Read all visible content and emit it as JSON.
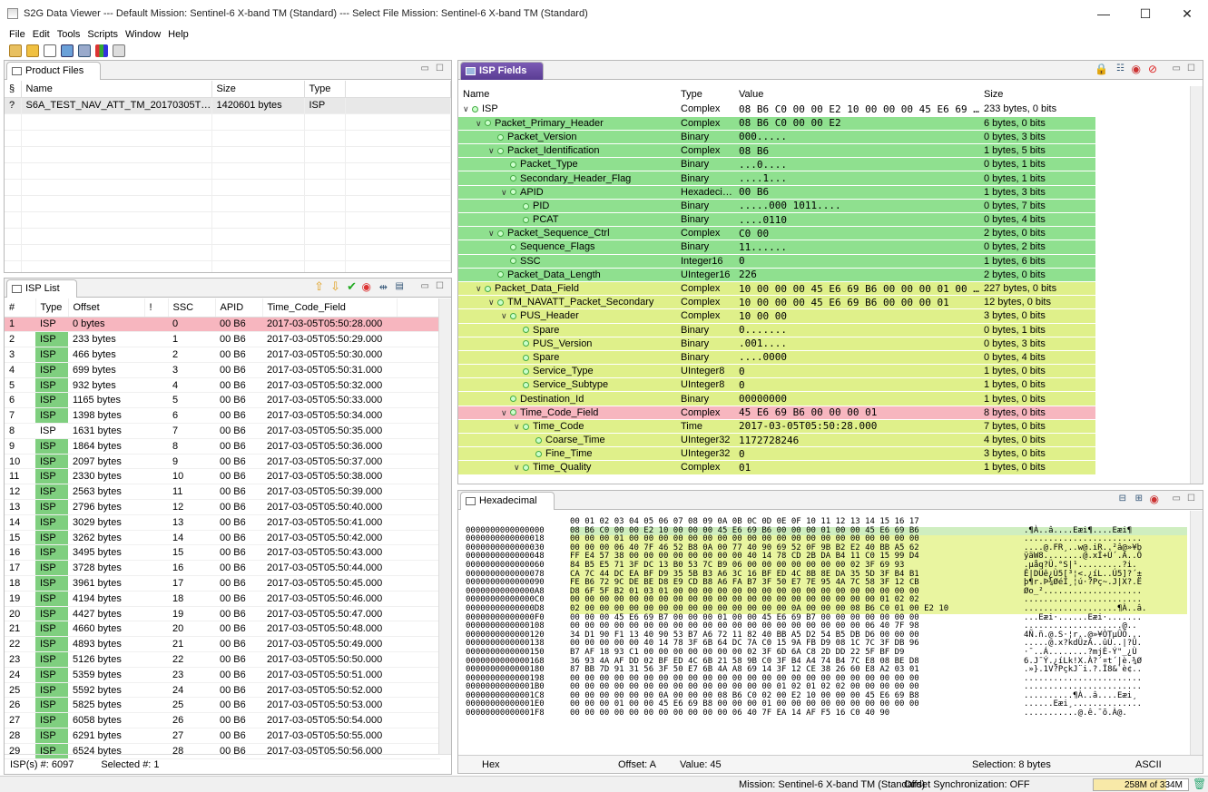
{
  "window": {
    "title": "S2G Data Viewer --- Default Mission: Sentinel-6 X-band TM (Standard) --- Select File Mission: Sentinel-6 X-band TM (Standard)",
    "minimize": "—",
    "maximize": "☐",
    "close": "✕"
  },
  "menu": [
    "File",
    "Edit",
    "Tools",
    "Scripts",
    "Window",
    "Help"
  ],
  "toolbar": [
    "open-folder-icon",
    "folder-icon",
    "properties-icon",
    "script-icon",
    "search-icon",
    "chart-icon",
    "export-icon"
  ],
  "product_files": {
    "tab": "Product Files",
    "headers": [
      "§",
      "Name",
      "Size",
      "Type"
    ],
    "rows": [
      [
        "?",
        "S6A_TEST_NAV_ATT_TM_20170305T055028...",
        "1420601 bytes",
        "ISP"
      ]
    ]
  },
  "isp_list": {
    "tab": "ISP List",
    "headers": [
      "#",
      "Type",
      "Offset",
      "!",
      "SSC",
      "APID",
      "Time_Code_Field"
    ],
    "rows": [
      [
        "1",
        "ISP",
        "0 bytes",
        "",
        "0",
        "00 B6",
        "2017-03-05T05:50:28.000"
      ],
      [
        "2",
        "ISP",
        "233 bytes",
        "",
        "1",
        "00 B6",
        "2017-03-05T05:50:29.000"
      ],
      [
        "3",
        "ISP",
        "466 bytes",
        "",
        "2",
        "00 B6",
        "2017-03-05T05:50:30.000"
      ],
      [
        "4",
        "ISP",
        "699 bytes",
        "",
        "3",
        "00 B6",
        "2017-03-05T05:50:31.000"
      ],
      [
        "5",
        "ISP",
        "932 bytes",
        "",
        "4",
        "00 B6",
        "2017-03-05T05:50:32.000"
      ],
      [
        "6",
        "ISP",
        "1165 bytes",
        "",
        "5",
        "00 B6",
        "2017-03-05T05:50:33.000"
      ],
      [
        "7",
        "ISP",
        "1398 bytes",
        "",
        "6",
        "00 B6",
        "2017-03-05T05:50:34.000"
      ],
      [
        "8",
        "ISP",
        "1631 bytes",
        "",
        "7",
        "00 B6",
        "2017-03-05T05:50:35.000"
      ],
      [
        "9",
        "ISP",
        "1864 bytes",
        "",
        "8",
        "00 B6",
        "2017-03-05T05:50:36.000"
      ],
      [
        "10",
        "ISP",
        "2097 bytes",
        "",
        "9",
        "00 B6",
        "2017-03-05T05:50:37.000"
      ],
      [
        "11",
        "ISP",
        "2330 bytes",
        "",
        "10",
        "00 B6",
        "2017-03-05T05:50:38.000"
      ],
      [
        "12",
        "ISP",
        "2563 bytes",
        "",
        "11",
        "00 B6",
        "2017-03-05T05:50:39.000"
      ],
      [
        "13",
        "ISP",
        "2796 bytes",
        "",
        "12",
        "00 B6",
        "2017-03-05T05:50:40.000"
      ],
      [
        "14",
        "ISP",
        "3029 bytes",
        "",
        "13",
        "00 B6",
        "2017-03-05T05:50:41.000"
      ],
      [
        "15",
        "ISP",
        "3262 bytes",
        "",
        "14",
        "00 B6",
        "2017-03-05T05:50:42.000"
      ],
      [
        "16",
        "ISP",
        "3495 bytes",
        "",
        "15",
        "00 B6",
        "2017-03-05T05:50:43.000"
      ],
      [
        "17",
        "ISP",
        "3728 bytes",
        "",
        "16",
        "00 B6",
        "2017-03-05T05:50:44.000"
      ],
      [
        "18",
        "ISP",
        "3961 bytes",
        "",
        "17",
        "00 B6",
        "2017-03-05T05:50:45.000"
      ],
      [
        "19",
        "ISP",
        "4194 bytes",
        "",
        "18",
        "00 B6",
        "2017-03-05T05:50:46.000"
      ],
      [
        "20",
        "ISP",
        "4427 bytes",
        "",
        "19",
        "00 B6",
        "2017-03-05T05:50:47.000"
      ],
      [
        "21",
        "ISP",
        "4660 bytes",
        "",
        "20",
        "00 B6",
        "2017-03-05T05:50:48.000"
      ],
      [
        "22",
        "ISP",
        "4893 bytes",
        "",
        "21",
        "00 B6",
        "2017-03-05T05:50:49.000"
      ],
      [
        "23",
        "ISP",
        "5126 bytes",
        "",
        "22",
        "00 B6",
        "2017-03-05T05:50:50.000"
      ],
      [
        "24",
        "ISP",
        "5359 bytes",
        "",
        "23",
        "00 B6",
        "2017-03-05T05:50:51.000"
      ],
      [
        "25",
        "ISP",
        "5592 bytes",
        "",
        "24",
        "00 B6",
        "2017-03-05T05:50:52.000"
      ],
      [
        "26",
        "ISP",
        "5825 bytes",
        "",
        "25",
        "00 B6",
        "2017-03-05T05:50:53.000"
      ],
      [
        "27",
        "ISP",
        "6058 bytes",
        "",
        "26",
        "00 B6",
        "2017-03-05T05:50:54.000"
      ],
      [
        "28",
        "ISP",
        "6291 bytes",
        "",
        "27",
        "00 B6",
        "2017-03-05T05:50:55.000"
      ],
      [
        "29",
        "ISP",
        "6524 bytes",
        "",
        "28",
        "00 B6",
        "2017-03-05T05:50:56.000"
      ]
    ],
    "count_label": "ISP(s) #: 6097",
    "selected_label": "Selected #: 1"
  },
  "isp_fields": {
    "tab": "ISP Fields",
    "headers": [
      "Name",
      "Type",
      "Value",
      "Size"
    ],
    "rows": [
      [
        0,
        "v",
        "ISP",
        "Complex",
        "08 B6 C0 00 00 E2 10 00 00 00 45 E6 69 B...",
        "233 bytes, 0 bits",
        "w"
      ],
      [
        1,
        "v",
        "Packet_Primary_Header",
        "Complex",
        "08 B6 C0 00 00 E2",
        "6 bytes, 0 bits",
        "g"
      ],
      [
        2,
        "",
        "Packet_Version",
        "Binary",
        "000.....",
        "0 bytes, 3 bits",
        "g"
      ],
      [
        2,
        "v",
        "Packet_Identification",
        "Complex",
        "08 B6",
        "1 bytes, 5 bits",
        "g"
      ],
      [
        3,
        "",
        "Packet_Type",
        "Binary",
        "...0....",
        "0 bytes, 1 bits",
        "g"
      ],
      [
        3,
        "",
        "Secondary_Header_Flag",
        "Binary",
        "....1...",
        "0 bytes, 1 bits",
        "g"
      ],
      [
        3,
        "v",
        "APID",
        "Hexadecimal",
        "00 B6",
        "1 bytes, 3 bits",
        "g"
      ],
      [
        4,
        "",
        "PID",
        "Binary",
        ".....000 1011....",
        "0 bytes, 7 bits",
        "g"
      ],
      [
        4,
        "",
        "PCAT",
        "Binary",
        "....0110",
        "0 bytes, 4 bits",
        "g"
      ],
      [
        2,
        "v",
        "Packet_Sequence_Ctrl",
        "Complex",
        "C0 00",
        "2 bytes, 0 bits",
        "g"
      ],
      [
        3,
        "",
        "Sequence_Flags",
        "Binary",
        "11......",
        "0 bytes, 2 bits",
        "g"
      ],
      [
        3,
        "",
        "SSC",
        "Integer16",
        "0",
        "1 bytes, 6 bits",
        "g"
      ],
      [
        2,
        "",
        "Packet_Data_Length",
        "UInteger16",
        "226",
        "2 bytes, 0 bits",
        "g"
      ],
      [
        1,
        "v",
        "Packet_Data_Field",
        "Complex",
        "10 00 00 00 45 E6 69 B6 00 00 00 01 00 0...",
        "227 bytes, 0 bits",
        "y"
      ],
      [
        2,
        "v",
        "TM_NAVATT_Packet_Secondary",
        "Complex",
        "10 00 00 00 45 E6 69 B6 00 00 00 01",
        "12 bytes, 0 bits",
        "y"
      ],
      [
        3,
        "v",
        "PUS_Header",
        "Complex",
        "10 00 00",
        "3 bytes, 0 bits",
        "y"
      ],
      [
        4,
        "",
        "Spare",
        "Binary",
        "0.......",
        "0 bytes, 1 bits",
        "y"
      ],
      [
        4,
        "",
        "PUS_Version",
        "Binary",
        ".001....",
        "0 bytes, 3 bits",
        "y"
      ],
      [
        4,
        "",
        "Spare",
        "Binary",
        "....0000",
        "0 bytes, 4 bits",
        "y"
      ],
      [
        4,
        "",
        "Service_Type",
        "UInteger8",
        "0",
        "1 bytes, 0 bits",
        "y"
      ],
      [
        4,
        "",
        "Service_Subtype",
        "UInteger8",
        "0",
        "1 bytes, 0 bits",
        "y"
      ],
      [
        3,
        "",
        "Destination_Id",
        "Binary",
        "00000000",
        "1 bytes, 0 bits",
        "y"
      ],
      [
        3,
        "v",
        "Time_Code_Field",
        "Complex",
        "45 E6 69 B6 00 00 00 01",
        "8 bytes, 0 bits",
        "p"
      ],
      [
        4,
        "v",
        "Time_Code",
        "Time",
        "2017-03-05T05:50:28.000",
        "7 bytes, 0 bits",
        "y"
      ],
      [
        5,
        "",
        "Coarse_Time",
        "UInteger32",
        "1172728246",
        "4 bytes, 0 bits",
        "y"
      ],
      [
        5,
        "",
        "Fine_Time",
        "UInteger32",
        "0",
        "3 bytes, 0 bits",
        "y"
      ],
      [
        4,
        "v",
        "Time_Quality",
        "Complex",
        "01",
        "1 bytes, 0 bits",
        "y"
      ]
    ]
  },
  "hex": {
    "tab": "Hexadecimal",
    "header": "00 01 02 03 04 05 06 07 08 09 0A 0B 0C 0D 0E 0F 10 11 12 13 14 15 16 17",
    "rows": [
      [
        "0000000000000000",
        "08 B6 C0 00 00 E2 10 00 00 00 45 E6 69 B6 00 00 00 01 00 00 45 E6 69 B6",
        ".¶À..â....Eæi¶....Eæi¶"
      ],
      [
        "0000000000000018",
        "00 00 00 01 00 00 00 00 00 00 00 00 00 00 00 00 00 00 00 00 00 00 00 00",
        "........................"
      ],
      [
        "0000000000000030",
        "00 00 00 06 40 7F 46 52 B8 0A 00 77 40 90 69 52 0F 9B B2 E2 40 BB A5 62",
        "....@.FR¸..w@.iR..²â@»¥b"
      ],
      [
        "0000000000000048",
        "FF E4 57 38 00 00 00 00 00 00 00 00 40 14 78 CD 2B DA B4 11 C0 15 99 D4",
        "ÿäW8........@.xÍ+Ú´.À..Ô"
      ],
      [
        "0000000000000060",
        "84 B5 E5 71 3F DC 13 B0 53 7C B9 06 00 00 00 00 00 00 00 02 3F 69 93",
        ".µåq?Ü.°S|¹.........?i."
      ],
      [
        "0000000000000078",
        "CA 7C 44 DC EA BF D9 35 5B B3 A6 3C 16 BF ED 4C 8B 8E DA 35 5D 3F B4 B1",
        "Ê|DÜê¿Ù5[³¦<.¿íL..Ú5]?´±"
      ],
      [
        "0000000000000090",
        "FE B6 72 9C DE BE D8 E9 CD B8 A6 FA B7 3F 50 E7 7E 95 4A 7C 58 3F 12 CB",
        "þ¶r.Þ¾ØéÍ¸¦ú·?Pç~.J|X?.Ë"
      ],
      [
        "00000000000000A8",
        "D8 6F 5F B2 01 03 01 00 00 00 00 00 00 00 00 00 00 00 00 00 00 00 00 00",
        "Øo_²...................."
      ],
      [
        "00000000000000C0",
        "00 00 00 00 00 00 00 00 00 00 00 00 00 00 00 00 00 00 00 00 00 01 02 02",
        "........................"
      ],
      [
        "00000000000000D8",
        "02 00 00 00 00 00 00 00 00 00 00 00 00 00 00 0A 00 00 00 08 B6 C0 01 00 E2 10",
        "...................¶À..â."
      ],
      [
        "00000000000000F0",
        "00 00 00 45 E6 69 B7 00 00 00 01 00 00 45 E6 69 B7 00 00 00 00 00 00 00",
        "...Eæi·......Eæi·......."
      ],
      [
        "0000000000000108",
        "00 00 00 00 00 00 00 00 00 00 00 00 00 00 00 00 00 00 00 00 06 40 7F 98",
        "....................@.."
      ],
      [
        "0000000000000120",
        "34 D1 90 F1 13 40 90 53 B7 A6 72 11 82 40 BB A5 D2 54 B5 DB D6 00 00 00",
        "4Ñ.ñ.@.S·¦r..@»¥ÒTµÛÖ..."
      ],
      [
        "0000000000000138",
        "00 00 00 00 00 40 14 78 3F 6B 64 DC 7A C0 15 9A FB D9 08 1C 7C 3F DB 96",
        ".....@.x?kdÜzÀ..ûÙ..|?Û."
      ],
      [
        "0000000000000150",
        "B7 AF 18 93 C1 00 00 00 00 00 00 00 02 3F 6D 6A C8 2D DD 22 5F BF D9",
        "·¯..Á........?mjÈ-Ý\"_¿Ù"
      ],
      [
        "0000000000000168",
        "36 93 4A AF DD 02 BF ED 4C 6B 21 58 9B C0 3F B4 A4 74 B4 7C E8 08 BE D8",
        "6.J¯Ý.¿íLk!X.À?´¤t´|è.¾Ø"
      ],
      [
        "0000000000000180",
        "87 BB 7D 91 31 56 3F 50 E7 6B 4A A8 69 14 3F 12 CE 38 26 60 E8 A2 03 01",
        ".»}.1V?PçkJ¨i.?.Î8&`è¢.."
      ],
      [
        "0000000000000198",
        "00 00 00 00 00 00 00 00 00 00 00 00 00 00 00 00 00 00 00 00 00 00 00 00",
        "........................"
      ],
      [
        "00000000000001B0",
        "00 00 00 00 00 00 00 00 00 00 00 00 00 00 01 02 01 02 02 00 00 00 00 00",
        "........................"
      ],
      [
        "00000000000001C8",
        "00 00 00 00 00 00 0A 00 00 00 08 B6 C0 02 00 E2 10 00 00 00 45 E6 69 B8",
        "..........¶À..â....Eæi¸"
      ],
      [
        "00000000000001E0",
        "00 00 00 01 00 00 45 E6 69 B8 00 00 00 01 00 00 00 00 00 00 00 00 00 00",
        "......Eæi¸.............."
      ],
      [
        "00000000000001F8",
        "00 00 00 00 00 00 00 00 00 00 00 06 40 7F EA 14 AF F5 16 C0 40 90",
        "...........@.ê.¯õ.À@."
      ]
    ],
    "footer": {
      "mode_left": "Hex",
      "offset": "Offset: A",
      "value": "Value: 45",
      "selection": "Selection: 8 bytes",
      "mode_right": "ASCII"
    }
  },
  "status": {
    "mission": "Mission: Sentinel-6 X-band TM (Standard)",
    "sync": "Offset Synchronization: OFF",
    "memory": "258M of 334M",
    "memory_fraction": 0.77
  },
  "colors": {
    "green": "#8fe08f",
    "yellow": "#dff08a",
    "pink": "#f7b6bf",
    "accent": "#6b4aa6"
  }
}
